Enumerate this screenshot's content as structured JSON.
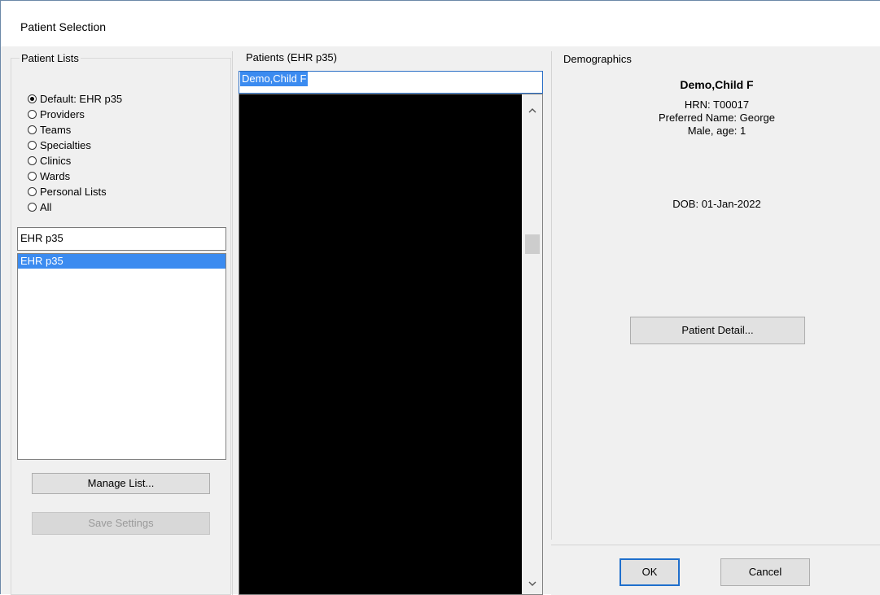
{
  "window": {
    "title": "Patient Selection"
  },
  "patient_lists": {
    "group_label": "Patient Lists",
    "radio_options": [
      {
        "label": "Default: EHR p35",
        "checked": true
      },
      {
        "label": "Providers",
        "checked": false
      },
      {
        "label": "Teams",
        "checked": false
      },
      {
        "label": "Specialties",
        "checked": false
      },
      {
        "label": "Clinics",
        "checked": false
      },
      {
        "label": "Wards",
        "checked": false
      },
      {
        "label": "Personal Lists",
        "checked": false
      },
      {
        "label": "All",
        "checked": false
      }
    ],
    "search_value": "EHR p35",
    "list_items": [
      "EHR p35"
    ],
    "manage_button": "Manage List...",
    "save_button": "Save Settings"
  },
  "patients": {
    "group_label": "Patients (EHR p35)",
    "search_value": "Demo,Child F"
  },
  "demographics": {
    "group_label": "Demographics",
    "name": "Demo,Child F",
    "hrn": "HRN: T00017",
    "preferred_name": "Preferred Name: George",
    "sex_age": "Male, age: 1",
    "dob": "DOB: 01-Jan-2022",
    "detail_button": "Patient Detail..."
  },
  "actions": {
    "ok_label": "OK",
    "cancel_label": "Cancel"
  },
  "icons": {
    "scroll_up": "chevron-up-icon",
    "scroll_down": "chevron-down-icon"
  },
  "colors": {
    "selection": "#3b8bf0",
    "default_button_border": "#1f6fcc"
  }
}
